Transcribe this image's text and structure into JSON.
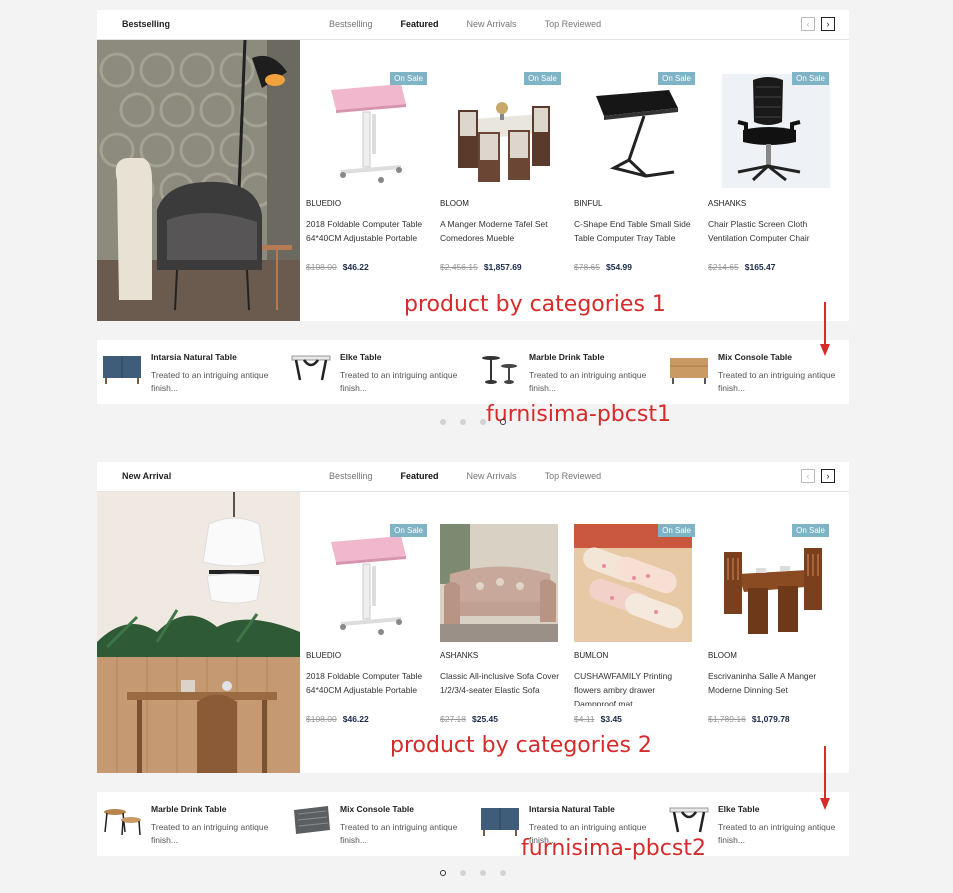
{
  "tabs": [
    "Bestselling",
    "Featured",
    "New Arrivals",
    "Top Reviewed"
  ],
  "active_tab": "Featured",
  "section1": {
    "title": "Bestselling",
    "products": [
      {
        "brand": "BLUEDIO",
        "name": "2018 Foldable Computer Table 64*40CM Adjustable Portable",
        "old_price": "$108.00",
        "price": "$46.22",
        "badge": "On Sale",
        "icon": "pink-laptop-table"
      },
      {
        "brand": "BLOOM",
        "name": "A Manger Moderne Tafel Set Comedores Mueble",
        "old_price": "$2,456.15",
        "price": "$1,857.69",
        "badge": "On Sale",
        "icon": "dining-table-set"
      },
      {
        "brand": "BiNFUL",
        "name": "C-Shape End Table Small Side Table Computer Tray Table",
        "old_price": "$78.65",
        "price": "$54.99",
        "badge": "On Sale",
        "icon": "c-shape-end-table"
      },
      {
        "brand": "ASHANKS",
        "name": "Chair Plastic Screen Cloth Ventilation Computer Chair",
        "old_price": "$214.65",
        "price": "$165.47",
        "badge": "On Sale",
        "icon": "office-chair"
      }
    ],
    "annotation": "product by categories 1",
    "strip": [
      {
        "title": "Intarsia Natural Table",
        "desc": "Treated to an intriguing antique finish...",
        "icon": "blue-cabinet"
      },
      {
        "title": "Elke Table",
        "desc": "Treated to an intriguing antique finish...",
        "icon": "elke-table"
      },
      {
        "title": "Marble Drink Table",
        "desc": "Treated to an intriguing antique finish...",
        "icon": "drink-tables"
      },
      {
        "title": "Mix Console Table",
        "desc": "Treated to an intriguing antique finish...",
        "icon": "wood-console"
      }
    ],
    "strip_annotation": "furnisima-pbcst1",
    "active_dot": 3
  },
  "section2": {
    "title": "New Arrival",
    "products": [
      {
        "brand": "BLUEDIO",
        "name": "2018 Foldable Computer Table 64*40CM Adjustable Portable",
        "old_price": "$108.00",
        "price": "$46.22",
        "badge": "On Sale",
        "icon": "pink-laptop-table"
      },
      {
        "brand": "ASHANKS",
        "name": "Classic All-inclusive Sofa Cover 1/2/3/4-seater Elastic Sofa",
        "old_price": "$27.18",
        "price": "$25.45",
        "badge": "",
        "icon": "sofa-cover"
      },
      {
        "brand": "BUMLON",
        "name": "CUSHAWFAMILY Printing flowers ambry drawer Dampproof mat",
        "old_price": "$4.11",
        "price": "$3.45",
        "badge": "On Sale",
        "icon": "mat-rolls"
      },
      {
        "brand": "BLOOM",
        "name": "Escrivaninha Salle A Manger Moderne Dinning Set",
        "old_price": "$1,789.16",
        "price": "$1,079.78",
        "badge": "On Sale",
        "icon": "wood-dining-set"
      }
    ],
    "annotation": "product by categories 2",
    "strip": [
      {
        "title": "Marble Drink Table",
        "desc": "Treated to an intriguing antique finish...",
        "icon": "nesting-tables"
      },
      {
        "title": "Mix Console Table",
        "desc": "Treated to an intriguing antique finish...",
        "icon": "woven-rug"
      },
      {
        "title": "Intarsia Natural Table",
        "desc": "Treated to an intriguing antique finish...",
        "icon": "blue-cabinet"
      },
      {
        "title": "Elke Table",
        "desc": "Treated to an intriguing antique finish...",
        "icon": "elke-table"
      }
    ],
    "strip_annotation": "furnisima-pbcst2",
    "active_dot": 0
  },
  "colors": {
    "accent_badge": "#7fb3c6",
    "price": "#1b2a4a",
    "annotation": "#d62b2b"
  }
}
